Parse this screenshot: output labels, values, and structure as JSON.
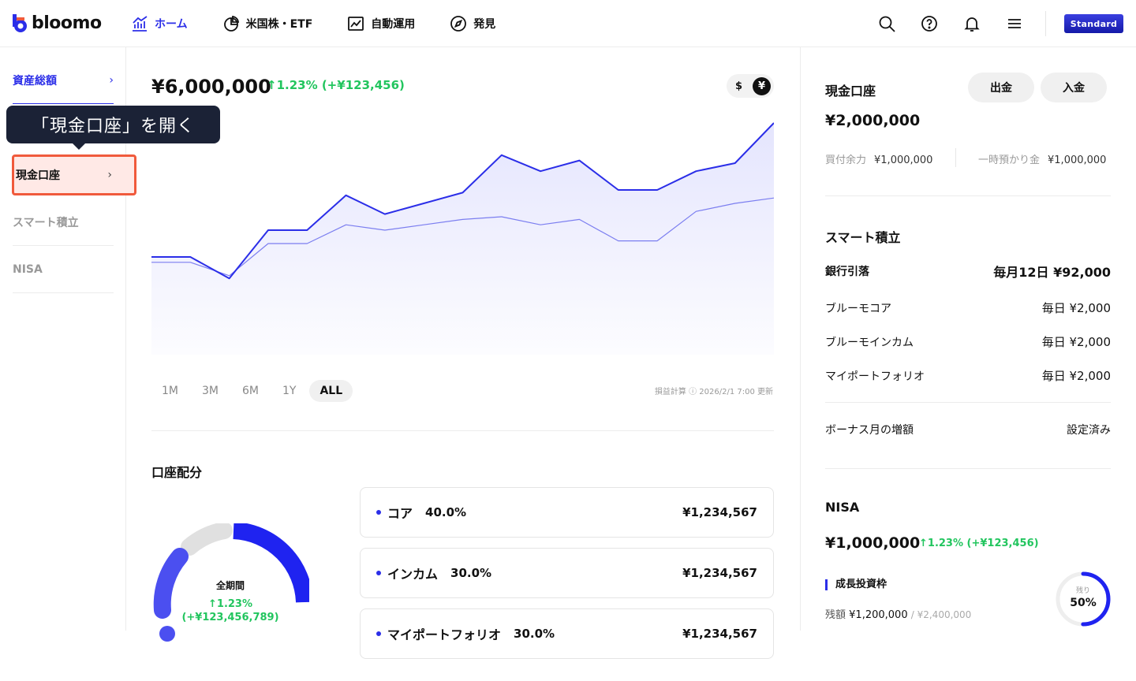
{
  "header": {
    "logo_text": "bloomo",
    "nav": [
      {
        "label": "ホーム",
        "icon": "chart-icon",
        "active": true
      },
      {
        "label": "米国株・ETF",
        "icon": "pie-icon",
        "active": false
      },
      {
        "label": "自動運用",
        "icon": "trend-icon",
        "active": false
      },
      {
        "label": "発見",
        "icon": "compass-icon",
        "active": false
      }
    ],
    "plan_badge": "Standard"
  },
  "sidebar": {
    "items": [
      {
        "label": "資産総額",
        "state": "active"
      },
      {
        "label": "現金口座",
        "state": "highlighted"
      },
      {
        "label": "スマート積立",
        "state": "default"
      },
      {
        "label": "NISA",
        "state": "default"
      }
    ],
    "tooltip": "「現金口座」を開く"
  },
  "main": {
    "total": "¥6,000,000",
    "change": "↑1.23% (+¥123,456)",
    "currency": {
      "usd": "$",
      "jpy": "¥",
      "selected": "jpy"
    },
    "ranges": [
      "1M",
      "3M",
      "6M",
      "1Y",
      "ALL"
    ],
    "selected_range": "ALL",
    "updated": "損益計算 ⓘ  2026/2/1 7:00 更新",
    "allocation_title": "口座配分",
    "donut": {
      "label": "全期間",
      "pct": "↑1.23%",
      "amount": "(+¥123,456,789)"
    },
    "allocations": [
      {
        "name": "コア",
        "pct": "40.0%",
        "amount": "¥1,234,567"
      },
      {
        "name": "インカム",
        "pct": "30.0%",
        "amount": "¥1,234,567"
      },
      {
        "name": "マイポートフォリオ",
        "pct": "30.0%",
        "amount": "¥1,234,567"
      }
    ]
  },
  "chart_data": {
    "type": "area",
    "title": "",
    "xlabel": "",
    "ylabel": "",
    "grid": false,
    "series": [
      {
        "values": [
          50,
          50,
          42,
          60,
          60,
          73,
          66,
          70,
          74,
          88,
          82,
          86,
          75,
          75,
          82,
          85,
          100
        ]
      },
      {
        "values": [
          48,
          48,
          43,
          55,
          55,
          62,
          60,
          62,
          64,
          65,
          62,
          64,
          56,
          56,
          67,
          70,
          72
        ]
      }
    ],
    "colors": {
      "primary": "#2b2ee8",
      "secondary": "#7b7ef0"
    }
  },
  "right": {
    "cash": {
      "title": "現金口座",
      "withdraw": "出金",
      "deposit": "入金",
      "amount": "¥2,000,000",
      "buying_power_label": "買付余力",
      "buying_power": "¥1,000,000",
      "deposit_temp_label": "一時預かり金",
      "deposit_temp": "¥1,000,000"
    },
    "smart": {
      "title": "スマート積立",
      "bank_label": "銀行引落",
      "bank_value": "毎月12日 ¥92,000",
      "rows": [
        {
          "label": "ブルーモコア",
          "value": "毎日 ¥2,000"
        },
        {
          "label": "ブルーモインカム",
          "value": "毎日 ¥2,000"
        },
        {
          "label": "マイポートフォリオ",
          "value": "毎日 ¥2,000"
        }
      ],
      "bonus_label": "ボーナス月の増額",
      "bonus_value": "設定済み"
    },
    "nisa": {
      "title": "NISA",
      "amount": "¥1,000,000",
      "change": "↑1.23% (+¥123,456)",
      "sub_title": "成長投資枠",
      "remaining_label": "残額",
      "remaining": "¥1,200,000",
      "limit": "¥2,400,000",
      "ring_label": "残り",
      "ring_pct": "50%",
      "ring_fraction": 0.5
    }
  }
}
